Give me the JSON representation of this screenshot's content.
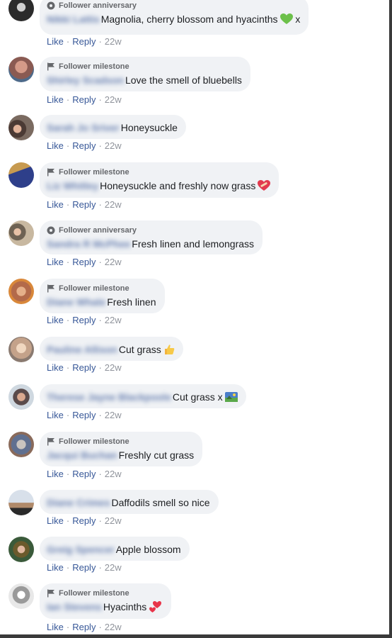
{
  "comments": [
    {
      "avatar_color": "#2b2b2b",
      "badge": "Follower anniversary",
      "badge_icon": "anniversary-icon",
      "name": "Nikki Lattis",
      "text": "Magnolia, cherry blossom and hyacinths",
      "suffix": " x",
      "emoji": "green-heart-icon",
      "like": "Like",
      "reply": "Reply",
      "time": "22w"
    },
    {
      "avatar_color": "#8a5a52",
      "badge": "Follower milestone",
      "badge_icon": "flag-icon",
      "name": "Shirley Scadson",
      "text": "Love the smell of bluebells",
      "suffix": "",
      "emoji": "",
      "like": "Like",
      "reply": "Reply",
      "time": "22w"
    },
    {
      "avatar_color": "#4b3a34",
      "badge": "",
      "badge_icon": "",
      "name": "Sarah Jo Sriver",
      "text": "Honeysuckle",
      "suffix": "",
      "emoji": "",
      "like": "Like",
      "reply": "Reply",
      "time": "22w"
    },
    {
      "avatar_color": "#2e3f8a",
      "badge": "Follower milestone",
      "badge_icon": "flag-icon",
      "name": "Liz Whitley",
      "text": "Honeysuckle and freshly now grass",
      "suffix": "",
      "emoji": "heart-bandage-icon",
      "like": "Like",
      "reply": "Reply",
      "time": "22w"
    },
    {
      "avatar_color": "#6e6253",
      "badge": "Follower anniversary",
      "badge_icon": "anniversary-icon",
      "name": "Sandra R McPhee",
      "text": "Fresh linen and lemongrass",
      "suffix": "",
      "emoji": "",
      "like": "Like",
      "reply": "Reply",
      "time": "22w"
    },
    {
      "avatar_color": "#b36a4a",
      "badge": "Follower milestone",
      "badge_icon": "flag-icon",
      "name": "Diane Whale",
      "text": "Fresh linen",
      "suffix": "",
      "emoji": "",
      "like": "Like",
      "reply": "Reply",
      "time": "22w"
    },
    {
      "avatar_color": "#c4a28a",
      "badge": "",
      "badge_icon": "",
      "name": "Pauline Allison",
      "text": "Cut grass",
      "suffix": "",
      "emoji": "thumbs-up-icon",
      "like": "Like",
      "reply": "Reply",
      "time": "22w"
    },
    {
      "avatar_color": "#5a4a4a",
      "badge": "",
      "badge_icon": "",
      "name": "Therese Jayne Blackpoole",
      "text": "Cut grass x",
      "suffix": "",
      "emoji": "landscape-icon",
      "like": "Like",
      "reply": "Reply",
      "time": "22w"
    },
    {
      "avatar_color": "#607090",
      "badge": "Follower milestone",
      "badge_icon": "flag-icon",
      "name": "Jacqui Buchan",
      "text": "Freshly cut grass",
      "suffix": "",
      "emoji": "",
      "like": "Like",
      "reply": "Reply",
      "time": "22w"
    },
    {
      "avatar_color": "#b08a6a",
      "badge": "",
      "badge_icon": "",
      "name": "Diane Crimes",
      "text": "Daffodils smell so nice",
      "suffix": "",
      "emoji": "",
      "like": "Like",
      "reply": "Reply",
      "time": "22w"
    },
    {
      "avatar_color": "#6b5a2c",
      "badge": "",
      "badge_icon": "",
      "name": "Greig Spencer",
      "text": "Apple blossom",
      "suffix": "",
      "emoji": "",
      "like": "Like",
      "reply": "Reply",
      "time": "22w"
    },
    {
      "avatar_color": "#9a9a9a",
      "badge": "Follower milestone",
      "badge_icon": "flag-icon",
      "name": "Ian Stevens",
      "text": "Hyacinths",
      "suffix": "",
      "emoji": "two-hearts-icon",
      "like": "Like",
      "reply": "Reply",
      "time": "22w"
    }
  ]
}
